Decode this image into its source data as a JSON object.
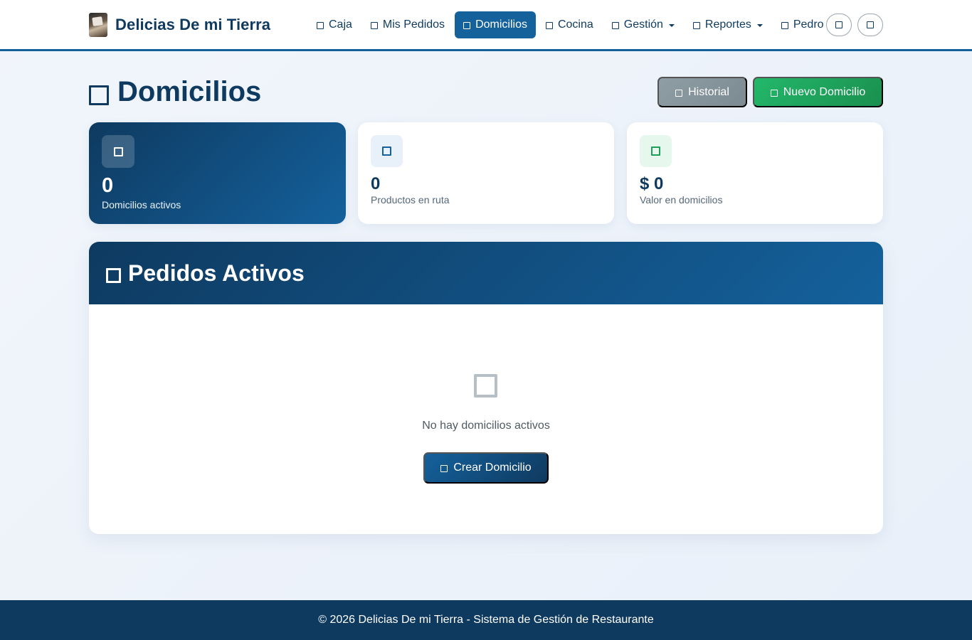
{
  "brand": {
    "name": "Delicias De mi Tierra",
    "logo_icon": "restaurant-logo"
  },
  "nav": {
    "items": [
      {
        "label": "Caja",
        "icon": "square-icon"
      },
      {
        "label": "Mis Pedidos",
        "icon": "square-icon"
      },
      {
        "label": "Domicilios",
        "icon": "square-icon",
        "active": true
      },
      {
        "label": "Cocina",
        "icon": "square-icon"
      },
      {
        "label": "Gestión",
        "icon": "square-icon",
        "dropdown": true
      },
      {
        "label": "Reportes",
        "icon": "square-icon",
        "dropdown": true
      },
      {
        "label": "Pedro",
        "icon": "square-icon",
        "dropdown": true
      }
    ],
    "circle_buttons": [
      "square-icon",
      "square-icon"
    ]
  },
  "page": {
    "title": "Domicilios",
    "historial_label": "Historial",
    "nuevo_label": "Nuevo Domicilio"
  },
  "stats": [
    {
      "value": "0",
      "label": "Domicilios activos"
    },
    {
      "value": "0",
      "label": "Productos en ruta"
    },
    {
      "value": "$ 0",
      "label": "Valor en domicilios"
    }
  ],
  "panel": {
    "title": "Pedidos Activos",
    "empty_text": "No hay domicilios activos",
    "create_label": "Crear Domicilio"
  },
  "footer": {
    "text": "© 2026 Delicias De mi Tierra - Sistema de Gestión de Restaurante"
  },
  "colors": {
    "primary": "#14619c",
    "primary_dark": "#0f3a5f",
    "success": "#1f9e5a",
    "secondary": "#8f9da5"
  }
}
